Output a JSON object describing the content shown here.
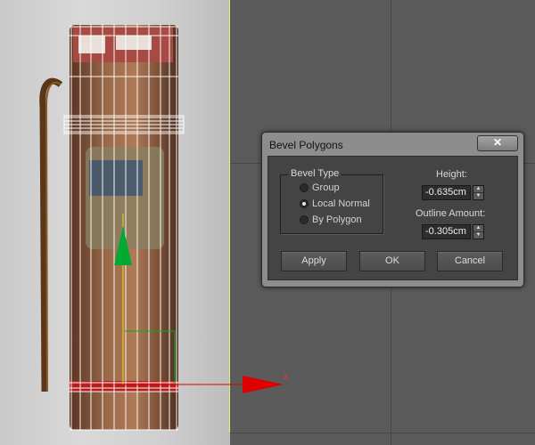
{
  "dialog": {
    "title": "Bevel Polygons",
    "close_label": "✕",
    "bevel_type": {
      "legend": "Bevel Type",
      "options": [
        {
          "label": "Group",
          "checked": false
        },
        {
          "label": "Local Normal",
          "checked": true
        },
        {
          "label": "By Polygon",
          "checked": false
        }
      ]
    },
    "height": {
      "label": "Height:",
      "value": "-0.635cm"
    },
    "outline_amount": {
      "label": "Outline Amount:",
      "value": "-0.305cm"
    },
    "buttons": {
      "apply": "Apply",
      "ok": "OK",
      "cancel": "Cancel"
    }
  },
  "viewport": {
    "gizmo_axis_label": "x",
    "colors": {
      "background": "#5b5b5b",
      "gizmo_x": "#dd0000",
      "gizmo_y": "#00aa33",
      "selection": "#ffffff",
      "plate_edge": "#e8f27a"
    }
  },
  "icons": {
    "radio": "radio-button",
    "spinner": "spinner-arrows",
    "close": "close-x"
  }
}
